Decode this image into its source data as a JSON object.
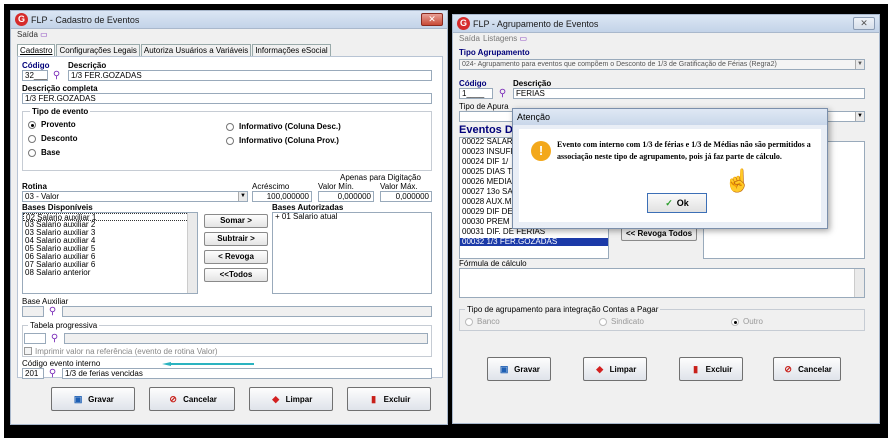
{
  "left_window": {
    "title": "FLP - Cadastro de Eventos",
    "logo": "G",
    "menu_exit": "Saída",
    "tabs": [
      "Cadastro",
      "Configurações Legais",
      "Autoriza Usuários a Variáveis",
      "Informações eSocial"
    ],
    "codigo_label": "Código",
    "codigo_value": "32___",
    "descricao_label": "Descrição",
    "descricao_value": "1/3 FER.GOZADAS",
    "desc_completa_label": "Descrição completa",
    "desc_completa_value": "1/3 FER.GOZADAS",
    "tipo_evento_label": "Tipo de evento",
    "tipo_options": [
      "Provento",
      "Desconto",
      "Base",
      "Informativo (Coluna Desc.)",
      "Informativo (Coluna Prov.)"
    ],
    "apenas_label": "Apenas para Digitação",
    "rotina_label": "Rotina",
    "rotina_value": "03 - Valor",
    "acrescimo_label": "Acréscimo",
    "acrescimo_value": "100,000000",
    "valor_min_label": "Valor Mín.",
    "valor_min_value": "0,000000",
    "valor_max_label": "Valor Máx.",
    "valor_max_value": "0,000000",
    "bases_disp_label": "Bases Disponíveis",
    "bases_disp": [
      "02 Salario auxiliar 1",
      "03 Salario auxiliar 2",
      "03 Salario auxiliar 3",
      "04 Salario auxiliar 4",
      "05 Salario auxiliar 5",
      "06 Salario auxiliar 6",
      "07 Salario auxiliar 6",
      "08 Salario anterior"
    ],
    "btn_somar": "Somar >",
    "btn_subtrair": "Subtrair >",
    "btn_revoga": "< Revoga",
    "btn_todos": "<<Todos",
    "bases_aut_label": "Bases Autorizadas",
    "bases_aut": [
      "+ 01 Salario atual"
    ],
    "base_aux_label": "Base Auxiliar",
    "tabela_label": "Tabela progressiva",
    "imprimir_label": "Imprimir valor na referência (evento de rotina Valor)",
    "cod_interno_label": "Código evento interno",
    "cod_interno_value": "201",
    "cod_interno_desc": "1/3 de ferias vencidas",
    "buttons": [
      "Gravar",
      "Cancelar",
      "Limpar",
      "Excluir"
    ]
  },
  "right_window": {
    "title": "FLP - Agrupamento de Eventos",
    "logo": "G",
    "menu": [
      "Saída",
      "Listagens"
    ],
    "tipo_agrup_label": "Tipo Agrupamento",
    "tipo_agrup_value": "024- Agrupamento para eventos que compõem o Desconto de 1/3 de Gratificação de Férias (Regra2)",
    "codigo_label": "Código",
    "codigo_value": "1____",
    "descricao_label": "Descrição",
    "descricao_value": "FERIAS",
    "tipo_apuracao_label": "Tipo de Apura",
    "eventos_label": "Eventos D",
    "eventos": [
      "00022 SALAR",
      "00023 INSUFI",
      "00024 DIF 1/",
      "00025 DIAS T",
      "00026 MEDIA",
      "00027 13o SA",
      "00028 AUX.M",
      "00029 DIF DE",
      "00030 PREM",
      "00031 DIF. DE FERIAS",
      "00032 1/3 FER.GOZADAS"
    ],
    "btn_revoga_todos": "<< Revoga Todos",
    "formula_label": "Fórmula de cálculo",
    "integracao_label": "Tipo de agrupamento para integração Contas a Pagar",
    "integracao_options": [
      "Banco",
      "Sindicato",
      "Outro"
    ],
    "buttons": [
      "Gravar",
      "Limpar",
      "Excluir",
      "Cancelar"
    ]
  },
  "dialog": {
    "title": "Atenção",
    "message": "Evento com interno com 1/3 de  férias e 1/3 de Médias não são permitidos a associação neste tipo de agrupamento, pois já faz parte de cálculo.",
    "ok_label": "Ok"
  },
  "colors": {
    "accent": "#1c3aa8",
    "label_blue": "#00007a",
    "warning": "#f3a81b",
    "logo_red": "#d62b2b",
    "arrow": "#2ab3c0"
  }
}
